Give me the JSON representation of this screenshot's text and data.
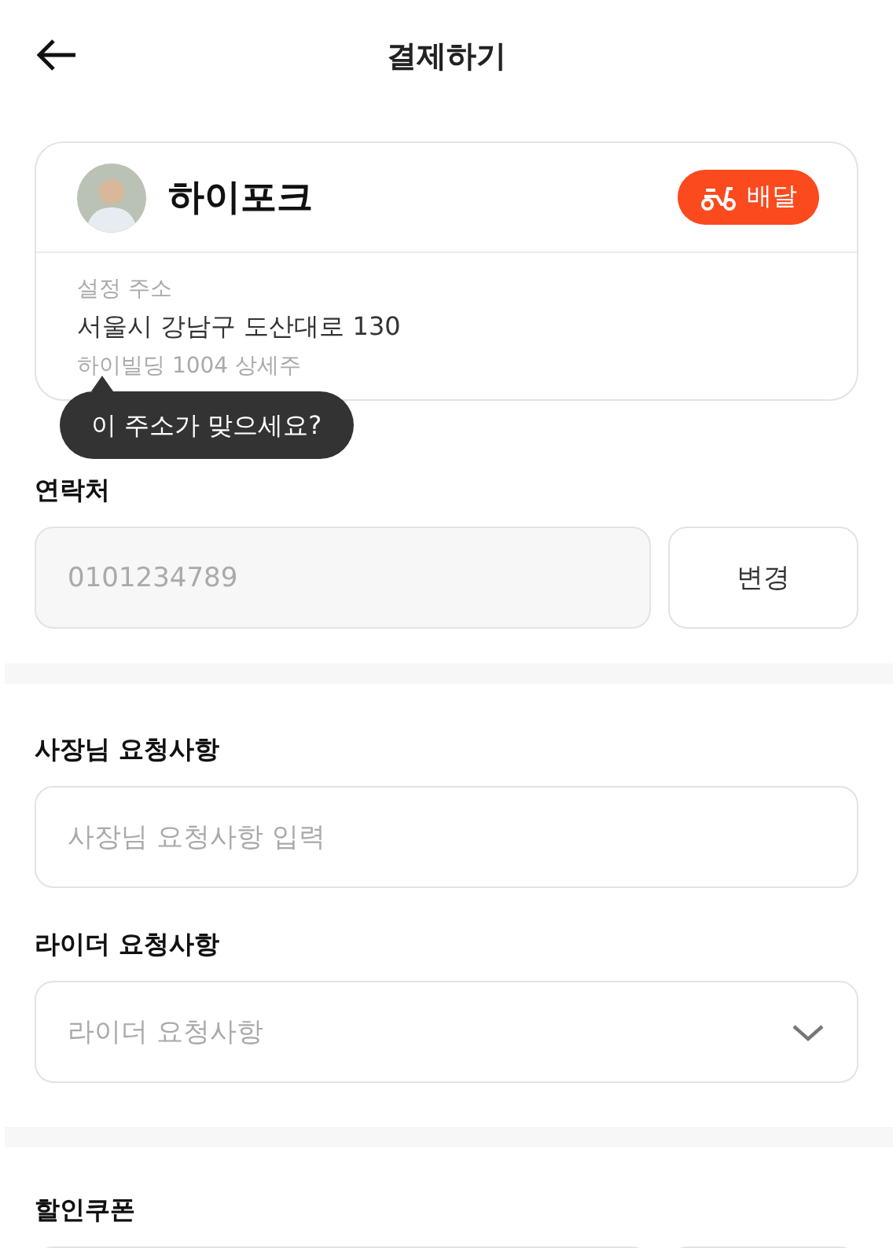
{
  "header": {
    "title": "결제하기"
  },
  "store": {
    "name": "하이포크",
    "badge": "배달",
    "address_label": "설정 주소",
    "address": "서울시 강남구 도산대로 130",
    "address_detail": "하이빌딩 1004 상세주"
  },
  "tooltip": "이 주소가 맞으세요?",
  "contact": {
    "label": "연락처",
    "value": "0101234789",
    "button": "변경"
  },
  "owner_request": {
    "label": "사장님 요청사항",
    "placeholder": "사장님 요청사항 입력"
  },
  "rider_request": {
    "label": "라이더 요청사항",
    "placeholder": "라이더 요청사항"
  },
  "coupon": {
    "label": "할인쿠폰"
  }
}
